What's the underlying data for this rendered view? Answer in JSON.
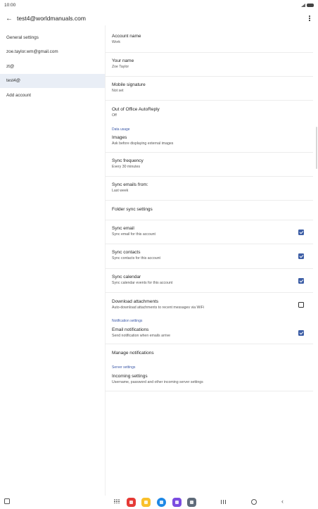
{
  "status_bar": {
    "time": "10:00"
  },
  "app_bar": {
    "title": "test4@worldmanuals.com"
  },
  "sidebar": {
    "items": [
      {
        "label": "General settings"
      },
      {
        "label": "zoe.taylor.wm@gmail.com"
      },
      {
        "label": "zt@"
      },
      {
        "label": "test4@",
        "active": true
      },
      {
        "label": "Add account"
      }
    ]
  },
  "settings": {
    "account_name": {
      "title": "Account name",
      "value": "Work"
    },
    "your_name": {
      "title": "Your name",
      "value": "Zoe Taylor"
    },
    "signature": {
      "title": "Mobile signature",
      "value": "Not set"
    },
    "out_of_office": {
      "title": "Out of Office AutoReply",
      "value": "Off"
    },
    "data_usage_heading": "Data usage",
    "images": {
      "title": "Images",
      "value": "Ask before displaying external images"
    },
    "sync_frequency": {
      "title": "Sync frequency",
      "value": "Every 30 minutes"
    },
    "sync_from": {
      "title": "Sync emails from:",
      "value": "Last week"
    },
    "folder_sync": {
      "title": "Folder sync settings"
    },
    "sync_email": {
      "title": "Sync email",
      "value": "Sync email for this account",
      "checked": true
    },
    "sync_contacts": {
      "title": "Sync contacts",
      "value": "Sync contacts for this account",
      "checked": true
    },
    "sync_calendar": {
      "title": "Sync calendar",
      "value": "Sync calendar events for this account",
      "checked": true
    },
    "download_attachments": {
      "title": "Download attachments",
      "value": "Auto-download attachments to recent messages via WiFi",
      "checked": false
    },
    "notification_heading": "Notification settings",
    "email_notifications": {
      "title": "Email notifications",
      "value": "Send notification when emails arrive",
      "checked": true
    },
    "manage_notifications": {
      "title": "Manage notifications"
    },
    "server_heading": "Server settings",
    "incoming": {
      "title": "Incoming settings",
      "value": "Username, password and other incoming server settings"
    }
  },
  "colors": {
    "accent": "#3e5fa6",
    "selected_bg": "#e9eef6",
    "section_heading": "#3d5aa8"
  },
  "icons": [
    "back-arrow-icon",
    "more-vert-icon",
    "checkbox-icon",
    "keyboard-icon",
    "apps-grid-icon",
    "recents-icon",
    "home-icon",
    "back-nav-icon"
  ]
}
